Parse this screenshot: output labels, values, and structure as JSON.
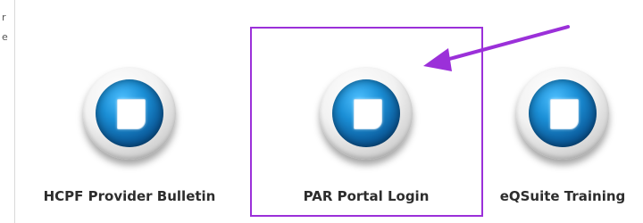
{
  "left_edge": {
    "fragments": [
      "r",
      "e"
    ]
  },
  "tiles": [
    {
      "label": "HCPF Provider Bulletin",
      "icon": "document-icon"
    },
    {
      "label": "PAR Portal Login",
      "icon": "document-icon"
    },
    {
      "label": "eQSuite Training",
      "icon": "document-icon"
    }
  ],
  "annotation": {
    "box_color": "#9b30d9",
    "arrow_color": "#9b30d9"
  }
}
